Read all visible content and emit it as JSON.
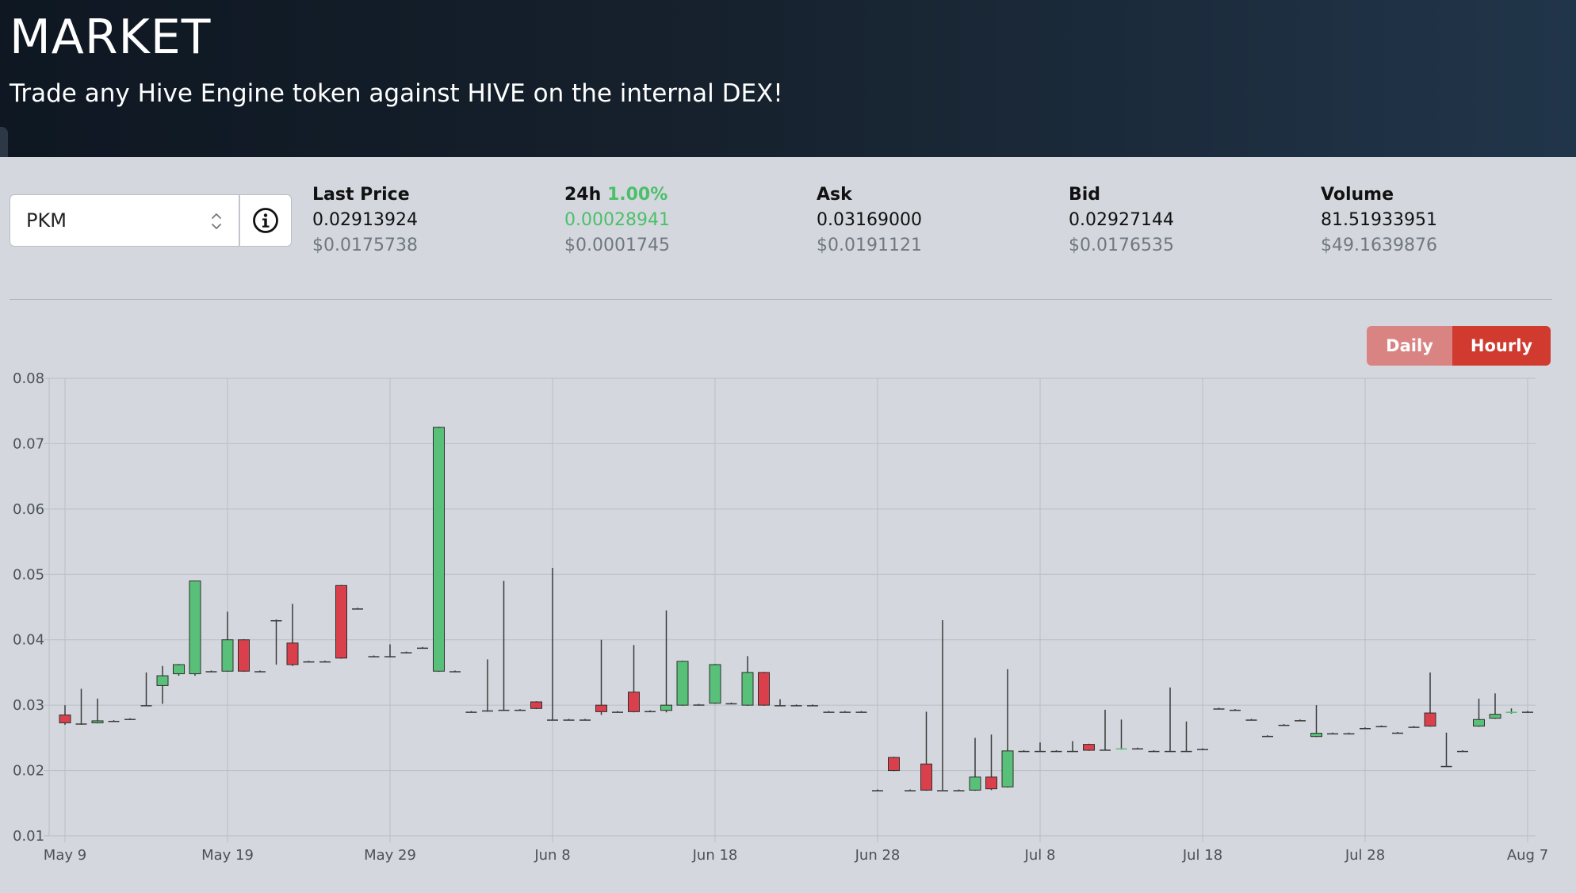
{
  "header": {
    "title": "MARKET",
    "subtitle": "Trade any Hive Engine token against HIVE on the internal DEX!"
  },
  "selector": {
    "token": "PKM"
  },
  "stats": {
    "last_price": {
      "label": "Last Price",
      "value": "0.02913924",
      "usd": "$0.0175738"
    },
    "change": {
      "label": "24h",
      "percent": "1.00%",
      "value": "0.00028941",
      "usd": "$0.0001745"
    },
    "ask": {
      "label": "Ask",
      "value": "0.03169000",
      "usd": "$0.0191121"
    },
    "bid": {
      "label": "Bid",
      "value": "0.02927144",
      "usd": "$0.0176535"
    },
    "volume": {
      "label": "Volume",
      "value": "81.51933951",
      "usd": "$49.1639876"
    }
  },
  "toggle": {
    "daily": "Daily",
    "hourly": "Hourly",
    "active": "hourly"
  },
  "colors": {
    "up": "#59c07a",
    "down": "#d9404c",
    "wick": "#3a3a3a",
    "grid": "#b8bec6"
  },
  "chart_data": {
    "type": "candlestick",
    "ylim": [
      0.01,
      0.08
    ],
    "yticks": [
      "0.01",
      "0.02",
      "0.03",
      "0.04",
      "0.05",
      "0.06",
      "0.07",
      "0.08"
    ],
    "xticks": [
      {
        "day": 0,
        "label": "May 9"
      },
      {
        "day": 10,
        "label": "May 19"
      },
      {
        "day": 20,
        "label": "May 29"
      },
      {
        "day": 30,
        "label": "Jun 8"
      },
      {
        "day": 40,
        "label": "Jun 18"
      },
      {
        "day": 50,
        "label": "Jun 28"
      },
      {
        "day": 60,
        "label": "Jul 8"
      },
      {
        "day": 70,
        "label": "Jul 18"
      },
      {
        "day": 80,
        "label": "Jul 28"
      },
      {
        "day": 90,
        "label": "Aug 7"
      }
    ],
    "candles": [
      {
        "d": 0,
        "o": 0.0285,
        "c": 0.0273,
        "h": 0.03,
        "l": 0.027
      },
      {
        "d": 1,
        "o": 0.0272,
        "c": 0.0272,
        "h": 0.0325,
        "l": 0.027
      },
      {
        "d": 2,
        "o": 0.0273,
        "c": 0.0276,
        "h": 0.031,
        "l": 0.0272
      },
      {
        "d": 3,
        "o": 0.0276,
        "c": 0.0276,
        "h": 0.0277,
        "l": 0.0275
      },
      {
        "d": 4,
        "o": 0.0279,
        "c": 0.0279,
        "h": 0.028,
        "l": 0.0278
      },
      {
        "d": 5,
        "o": 0.03,
        "c": 0.03,
        "h": 0.035,
        "l": 0.0299
      },
      {
        "d": 6,
        "o": 0.033,
        "c": 0.0345,
        "h": 0.036,
        "l": 0.0302
      },
      {
        "d": 7,
        "o": 0.0348,
        "c": 0.0362,
        "h": 0.0363,
        "l": 0.0345
      },
      {
        "d": 8,
        "o": 0.0348,
        "c": 0.049,
        "h": 0.049,
        "l": 0.0345
      },
      {
        "d": 9,
        "o": 0.0352,
        "c": 0.0352,
        "h": 0.0353,
        "l": 0.0351
      },
      {
        "d": 10,
        "o": 0.0352,
        "c": 0.04,
        "h": 0.0443,
        "l": 0.0351
      },
      {
        "d": 11,
        "o": 0.04,
        "c": 0.0352,
        "h": 0.0401,
        "l": 0.0351
      },
      {
        "d": 12,
        "o": 0.0352,
        "c": 0.0352,
        "h": 0.0353,
        "l": 0.0351
      },
      {
        "d": 13,
        "o": 0.043,
        "c": 0.043,
        "h": 0.0431,
        "l": 0.0362
      },
      {
        "d": 14,
        "o": 0.0395,
        "c": 0.0362,
        "h": 0.0455,
        "l": 0.036
      },
      {
        "d": 15,
        "o": 0.0367,
        "c": 0.0367,
        "h": 0.0368,
        "l": 0.0366
      },
      {
        "d": 16,
        "o": 0.0367,
        "c": 0.0367,
        "h": 0.0368,
        "l": 0.0366
      },
      {
        "d": 17,
        "o": 0.0483,
        "c": 0.0372,
        "h": 0.0484,
        "l": 0.0371
      },
      {
        "d": 18,
        "o": 0.0448,
        "c": 0.0448,
        "h": 0.0449,
        "l": 0.0447
      },
      {
        "d": 19,
        "o": 0.0375,
        "c": 0.0375,
        "h": 0.0376,
        "l": 0.0374
      },
      {
        "d": 20,
        "o": 0.0375,
        "c": 0.0375,
        "h": 0.0393,
        "l": 0.0374
      },
      {
        "d": 21,
        "o": 0.0381,
        "c": 0.0381,
        "h": 0.0382,
        "l": 0.038
      },
      {
        "d": 22,
        "o": 0.0388,
        "c": 0.0388,
        "h": 0.0389,
        "l": 0.0387
      },
      {
        "d": 23,
        "o": 0.0352,
        "c": 0.0725,
        "h": 0.0726,
        "l": 0.0351
      },
      {
        "d": 24,
        "o": 0.0352,
        "c": 0.0352,
        "h": 0.0353,
        "l": 0.0351
      },
      {
        "d": 25,
        "o": 0.029,
        "c": 0.029,
        "h": 0.0291,
        "l": 0.0289
      },
      {
        "d": 26,
        "o": 0.0292,
        "c": 0.0292,
        "h": 0.037,
        "l": 0.029
      },
      {
        "d": 27,
        "o": 0.0293,
        "c": 0.0293,
        "h": 0.049,
        "l": 0.0292
      },
      {
        "d": 28,
        "o": 0.0293,
        "c": 0.0293,
        "h": 0.0294,
        "l": 0.0292
      },
      {
        "d": 29,
        "o": 0.0305,
        "c": 0.0295,
        "h": 0.0306,
        "l": 0.0294
      },
      {
        "d": 30,
        "o": 0.0278,
        "c": 0.0278,
        "h": 0.051,
        "l": 0.0277
      },
      {
        "d": 31,
        "o": 0.0278,
        "c": 0.0278,
        "h": 0.0279,
        "l": 0.0277
      },
      {
        "d": 32,
        "o": 0.0278,
        "c": 0.0278,
        "h": 0.0279,
        "l": 0.0277
      },
      {
        "d": 33,
        "o": 0.03,
        "c": 0.029,
        "h": 0.04,
        "l": 0.0285
      },
      {
        "d": 34,
        "o": 0.029,
        "c": 0.029,
        "h": 0.0291,
        "l": 0.0289
      },
      {
        "d": 35,
        "o": 0.032,
        "c": 0.029,
        "h": 0.0392,
        "l": 0.0289
      },
      {
        "d": 36,
        "o": 0.0291,
        "c": 0.0291,
        "h": 0.0292,
        "l": 0.029
      },
      {
        "d": 37,
        "o": 0.0292,
        "c": 0.03,
        "h": 0.0445,
        "l": 0.0289
      },
      {
        "d": 38,
        "o": 0.03,
        "c": 0.0367,
        "h": 0.0368,
        "l": 0.0299
      },
      {
        "d": 39,
        "o": 0.0301,
        "c": 0.0301,
        "h": 0.0302,
        "l": 0.03
      },
      {
        "d": 40,
        "o": 0.0303,
        "c": 0.0362,
        "h": 0.0363,
        "l": 0.0302
      },
      {
        "d": 41,
        "o": 0.0303,
        "c": 0.0303,
        "h": 0.0304,
        "l": 0.0302
      },
      {
        "d": 42,
        "o": 0.03,
        "c": 0.035,
        "h": 0.0375,
        "l": 0.0299
      },
      {
        "d": 43,
        "o": 0.035,
        "c": 0.03,
        "h": 0.0351,
        "l": 0.0299
      },
      {
        "d": 44,
        "o": 0.03,
        "c": 0.03,
        "h": 0.0309,
        "l": 0.0299
      },
      {
        "d": 45,
        "o": 0.03,
        "c": 0.03,
        "h": 0.0301,
        "l": 0.0299
      },
      {
        "d": 46,
        "o": 0.03,
        "c": 0.03,
        "h": 0.0301,
        "l": 0.0299
      },
      {
        "d": 47,
        "o": 0.029,
        "c": 0.029,
        "h": 0.0291,
        "l": 0.0289
      },
      {
        "d": 48,
        "o": 0.029,
        "c": 0.029,
        "h": 0.0291,
        "l": 0.0289
      },
      {
        "d": 49,
        "o": 0.029,
        "c": 0.029,
        "h": 0.0291,
        "l": 0.0289
      },
      {
        "d": 50,
        "o": 0.017,
        "c": 0.017,
        "h": 0.0171,
        "l": 0.0169
      },
      {
        "d": 51,
        "o": 0.022,
        "c": 0.02,
        "h": 0.0221,
        "l": 0.0199
      },
      {
        "d": 52,
        "o": 0.017,
        "c": 0.017,
        "h": 0.0171,
        "l": 0.0169
      },
      {
        "d": 53,
        "o": 0.021,
        "c": 0.017,
        "h": 0.029,
        "l": 0.0169
      },
      {
        "d": 54,
        "o": 0.017,
        "c": 0.017,
        "h": 0.043,
        "l": 0.0169
      },
      {
        "d": 55,
        "o": 0.017,
        "c": 0.017,
        "h": 0.0171,
        "l": 0.0169
      },
      {
        "d": 56,
        "o": 0.017,
        "c": 0.019,
        "h": 0.025,
        "l": 0.0169
      },
      {
        "d": 57,
        "o": 0.019,
        "c": 0.0172,
        "h": 0.0255,
        "l": 0.017
      },
      {
        "d": 58,
        "o": 0.0175,
        "c": 0.023,
        "h": 0.0355,
        "l": 0.0174
      },
      {
        "d": 59,
        "o": 0.023,
        "c": 0.023,
        "h": 0.0231,
        "l": 0.0229
      },
      {
        "d": 60,
        "o": 0.023,
        "c": 0.023,
        "h": 0.0243,
        "l": 0.0229
      },
      {
        "d": 61,
        "o": 0.023,
        "c": 0.023,
        "h": 0.0231,
        "l": 0.0229
      },
      {
        "d": 62,
        "o": 0.023,
        "c": 0.023,
        "h": 0.0245,
        "l": 0.0229
      },
      {
        "d": 63,
        "o": 0.024,
        "c": 0.0231,
        "h": 0.0241,
        "l": 0.023
      },
      {
        "d": 64,
        "o": 0.0232,
        "c": 0.0232,
        "h": 0.0293,
        "l": 0.0231
      },
      {
        "d": 65,
        "o": 0.0233,
        "c": 0.0234,
        "h": 0.0278,
        "l": 0.0232
      },
      {
        "d": 66,
        "o": 0.0234,
        "c": 0.0234,
        "h": 0.0235,
        "l": 0.0233
      },
      {
        "d": 67,
        "o": 0.023,
        "c": 0.023,
        "h": 0.0231,
        "l": 0.0229
      },
      {
        "d": 68,
        "o": 0.023,
        "c": 0.023,
        "h": 0.0327,
        "l": 0.0229
      },
      {
        "d": 69,
        "o": 0.023,
        "c": 0.023,
        "h": 0.0275,
        "l": 0.0229
      },
      {
        "d": 70,
        "o": 0.0233,
        "c": 0.0233,
        "h": 0.0234,
        "l": 0.0232
      },
      {
        "d": 71,
        "o": 0.0295,
        "c": 0.0295,
        "h": 0.0296,
        "l": 0.0294
      },
      {
        "d": 72,
        "o": 0.0293,
        "c": 0.0293,
        "h": 0.0294,
        "l": 0.0292
      },
      {
        "d": 73,
        "o": 0.0278,
        "c": 0.0278,
        "h": 0.0279,
        "l": 0.0277
      },
      {
        "d": 74,
        "o": 0.0253,
        "c": 0.0253,
        "h": 0.0254,
        "l": 0.0252
      },
      {
        "d": 75,
        "o": 0.027,
        "c": 0.027,
        "h": 0.0271,
        "l": 0.0269
      },
      {
        "d": 76,
        "o": 0.0277,
        "c": 0.0277,
        "h": 0.0278,
        "l": 0.0276
      },
      {
        "d": 77,
        "o": 0.0252,
        "c": 0.0257,
        "h": 0.03,
        "l": 0.0251
      },
      {
        "d": 78,
        "o": 0.0257,
        "c": 0.0257,
        "h": 0.0258,
        "l": 0.0256
      },
      {
        "d": 79,
        "o": 0.0257,
        "c": 0.0257,
        "h": 0.0258,
        "l": 0.0256
      },
      {
        "d": 80,
        "o": 0.0265,
        "c": 0.0265,
        "h": 0.0266,
        "l": 0.0264
      },
      {
        "d": 81,
        "o": 0.0268,
        "c": 0.0268,
        "h": 0.0269,
        "l": 0.0267
      },
      {
        "d": 82,
        "o": 0.0258,
        "c": 0.0258,
        "h": 0.0259,
        "l": 0.0257
      },
      {
        "d": 83,
        "o": 0.0267,
        "c": 0.0267,
        "h": 0.0268,
        "l": 0.0266
      },
      {
        "d": 84,
        "o": 0.0288,
        "c": 0.0268,
        "h": 0.035,
        "l": 0.0267
      },
      {
        "d": 85,
        "o": 0.0207,
        "c": 0.0207,
        "h": 0.0258,
        "l": 0.0206
      },
      {
        "d": 86,
        "o": 0.023,
        "c": 0.023,
        "h": 0.0231,
        "l": 0.0229
      },
      {
        "d": 87,
        "o": 0.0268,
        "c": 0.0278,
        "h": 0.031,
        "l": 0.0267
      },
      {
        "d": 88,
        "o": 0.028,
        "c": 0.0286,
        "h": 0.0318,
        "l": 0.0279
      },
      {
        "d": 89,
        "o": 0.0288,
        "c": 0.029,
        "h": 0.0295,
        "l": 0.0287
      },
      {
        "d": 90,
        "o": 0.029,
        "c": 0.029,
        "h": 0.0291,
        "l": 0.0289
      }
    ]
  }
}
